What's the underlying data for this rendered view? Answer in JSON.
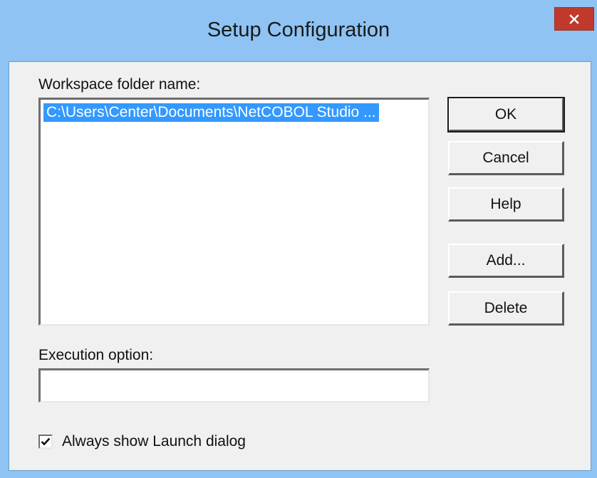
{
  "window": {
    "title": "Setup Configuration",
    "close_glyph": "✕"
  },
  "workspace": {
    "label": "Workspace folder name:",
    "items": [
      {
        "text": "C:\\Users\\Center\\Documents\\NetCOBOL Studio ...",
        "selected": true
      }
    ]
  },
  "execution": {
    "label": "Execution option:",
    "value": ""
  },
  "buttons": {
    "ok": "OK",
    "cancel": "Cancel",
    "help": "Help",
    "add": "Add...",
    "delete": "Delete"
  },
  "launch": {
    "label": "Always show Launch dialog",
    "checked": true
  },
  "colors": {
    "titlebar": "#8ec3f4",
    "close_button": "#c0392b",
    "selection": "#3399ff",
    "dialog_face": "#f0f0f0"
  }
}
